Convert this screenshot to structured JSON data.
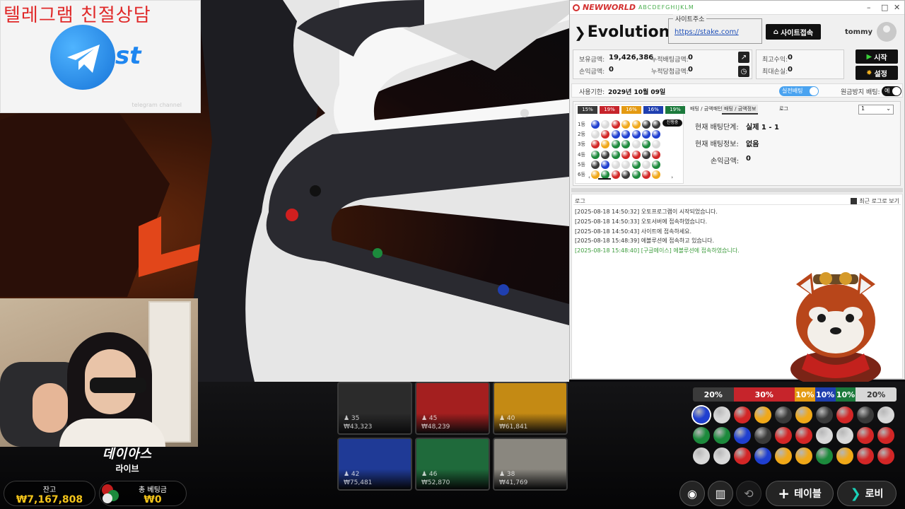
{
  "promo": {
    "title": "텔레그램 친절상담",
    "logo_text": "st",
    "watermark": "telegram channel"
  },
  "brand": {
    "line1": "데이아스",
    "line2": "라이브"
  },
  "balance": {
    "label": "잔고",
    "value": "₩7,167,808"
  },
  "total_bet": {
    "label": "총 베팅금",
    "value": "₩0"
  },
  "tiles": [
    {
      "color": "#2b2b2b",
      "count": "35",
      "amount": "₩43,323"
    },
    {
      "color": "#a41f1f",
      "count": "45",
      "amount": "₩48,239"
    },
    {
      "color": "#c48a14",
      "count": "40",
      "amount": "₩61,841"
    },
    {
      "color": "#1f3a96",
      "count": "42",
      "amount": "₩75,481"
    },
    {
      "color": "#1f6a3b",
      "count": "46",
      "amount": "₩52,870"
    },
    {
      "color": "#8a877f",
      "count": "38",
      "amount": "₩41,769"
    }
  ],
  "stats": [
    {
      "label": "20%",
      "color": "#3a3a3a",
      "value": 20
    },
    {
      "label": "30%",
      "color": "#c6242b",
      "value": 30
    },
    {
      "label": "10%",
      "color": "#e49a12",
      "value": 10
    },
    {
      "label": "10%",
      "color": "#1f3fb0",
      "value": 10
    },
    {
      "label": "10%",
      "color": "#1c7a3c",
      "value": 10
    },
    {
      "label": "20%",
      "color": "#d7d7d7",
      "value": 20
    }
  ],
  "ball_rows": [
    [
      "#1f3fd0",
      "#d8d8d8",
      "#d32626",
      "#f0a818",
      "#3a3a3a",
      "#f0a818",
      "#3a3a3a",
      "#d32626",
      "#3a3a3a",
      "#d8d8d8"
    ],
    [
      "#1c8a3c",
      "#1c8a3c",
      "#1f3fd0",
      "#3a3a3a",
      "#d32626",
      "#d32626",
      "#d8d8d8",
      "#d8d8d8",
      "#d32626",
      "#d32626"
    ],
    [
      "#d8d8d8",
      "#d8d8d8",
      "#d32626",
      "#1f3fd0",
      "#f0a818",
      "#f0a818",
      "#1c8a3c",
      "#f0a818",
      "#d32626",
      "#d32626"
    ]
  ],
  "toolbar": {
    "table_label": "테이블",
    "lobby_label": "로비",
    "plus": "+",
    "arrow": "›"
  },
  "app": {
    "title": "NEWWORLD",
    "subtitle": "ABCDEFGHIJKLM",
    "window_controls": {
      "min": "–",
      "max": "□",
      "close": "✕"
    },
    "logo": "Evolution",
    "logo_chevron": "❯",
    "site_label": "사이트주소",
    "site_url": "https://stake.com/",
    "connect_label": "사이트접속",
    "home_icon": "⌂",
    "username": "tommy",
    "info": {
      "holding_label": "보유금액:",
      "holding_value": "19,426,386",
      "acc_bet_label": "누적배팅금액:",
      "acc_bet_value": "0",
      "profit_label": "손익금액:",
      "profit_value": "0",
      "acc_win_label": "누적당첨금액:",
      "acc_win_value": "0"
    },
    "info2": {
      "max_profit_label": "최고수익:",
      "max_profit_value": "0",
      "max_loss_label": "최대손실:",
      "max_loss_value": "0"
    },
    "chart_icon": "↗",
    "clock_icon": "◷",
    "start_label": "시작",
    "start_icon": "▶",
    "settings_label": "설정",
    "settings_icon": "✹",
    "license_label": "사용기한:",
    "license_value": "2029년 10월 09일",
    "realbet_label": "실전배팅",
    "nowin_label": "원금방지 배팅:",
    "nowin_value": "예"
  },
  "mini": {
    "pcts": [
      {
        "label": "15%",
        "color": "#3a3a3a"
      },
      {
        "label": "19%",
        "color": "#c6242b"
      },
      {
        "label": "16%",
        "color": "#e49a12"
      },
      {
        "label": "16%",
        "color": "#1f3fb0"
      },
      {
        "label": "19%",
        "color": "#1c7a3c"
      }
    ],
    "rows": [
      {
        "label": "1등",
        "colors": [
          "#1f3fd0",
          "#d8d8d8",
          "#d32626",
          "#f0a818",
          "#f0a818",
          "#3a3a3a",
          "#3a3a3a"
        ]
      },
      {
        "label": "2등",
        "colors": [
          "#d8d8d8",
          "#d32626",
          "#1f3fd0",
          "#1f3fd0",
          "#1f3fd0",
          "#1f3fd0",
          "#1f3fd0"
        ]
      },
      {
        "label": "3등",
        "colors": [
          "#d32626",
          "#f0a818",
          "#1c8a3c",
          "#1c8a3c",
          "#d8d8d8",
          "#1c8a3c",
          "#d8d8d8"
        ]
      },
      {
        "label": "4등",
        "colors": [
          "#1c8a3c",
          "#3a3a3a",
          "#1c8a3c",
          "#d32626",
          "#d32626",
          "#3a3a3a",
          "#d32626"
        ]
      },
      {
        "label": "5등",
        "colors": [
          "#3a3a3a",
          "#1f3fd0",
          "#d8d8d8",
          "#d8d8d8",
          "#1c8a3c",
          "#d8d8d8",
          "#1c8a3c"
        ]
      },
      {
        "label": "6등",
        "colors": [
          "#f0a818",
          "#1c8a3c",
          "#d32626",
          "#3a3a3a",
          "#1c8a3c",
          "#d32626",
          "#f0a818"
        ]
      }
    ],
    "badge": "진행중",
    "scroll_left": "‹",
    "scroll_right": "›"
  },
  "tabs": [
    {
      "label": "배팅 / 금액패턴"
    },
    {
      "label": "배팅 / 금액정보"
    },
    {
      "label": "로그"
    }
  ],
  "dropdown": {
    "value": "1",
    "arrow": "⌄"
  },
  "bet_info": {
    "stage_label": "현재 배팅단계:",
    "stage_value": "실제 1 - 1",
    "info_label": "현재 배팅정보:",
    "info_value": "없음",
    "pnl_label": "손익금액:",
    "pnl_value": "0"
  },
  "log": {
    "header": "로그",
    "recent_label": "최근 로그로 보기",
    "lines": [
      {
        "text": "[2025-08-18 14:50:32] 오토프로그램이 시작되었습니다.",
        "color": "#333333"
      },
      {
        "text": "[2025-08-18 14:50:33] 오토서버에 접속하였습니다.",
        "color": "#333333"
      },
      {
        "text": "[2025-08-18 14:50:43] 사이트에 접속하세요.",
        "color": "#333333"
      },
      {
        "text": "[2025-08-18 15:48:39] 에볼루션에 접속하고 있습니다.",
        "color": "#333333"
      },
      {
        "text": "[2025-08-18 15:48:40] [구글메이스] 에볼루션에 접속하였습니다.",
        "color": "#3a9a3a"
      }
    ]
  }
}
